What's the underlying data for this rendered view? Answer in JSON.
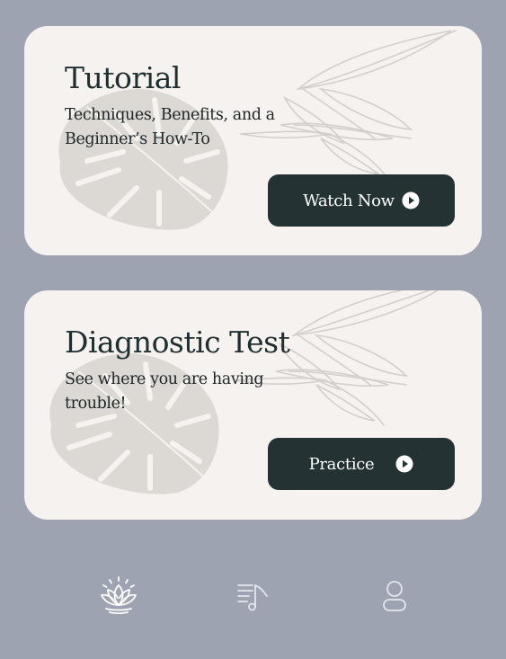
{
  "cards": [
    {
      "title": "Tutorial",
      "subtitle": "Techniques, Benefits, and a Beginner’s How-To",
      "button_label": "Watch Now",
      "button_icon": "play-circle-icon"
    },
    {
      "title": "Diagnostic Test",
      "subtitle": "See where you are having trouble!",
      "button_label": "Practice",
      "button_icon": "play-circle-icon"
    }
  ],
  "nav": {
    "items": [
      {
        "icon": "lotus-icon",
        "active": true
      },
      {
        "icon": "playlist-music-icon",
        "active": false
      },
      {
        "icon": "user-icon",
        "active": false
      }
    ]
  },
  "colors": {
    "background": "#9ea3b2",
    "card": "#f5f2ef",
    "button": "#243234",
    "text": "#1f2f30",
    "nav_active": "#ffffff",
    "nav_inactive": "#e2e4ea"
  }
}
